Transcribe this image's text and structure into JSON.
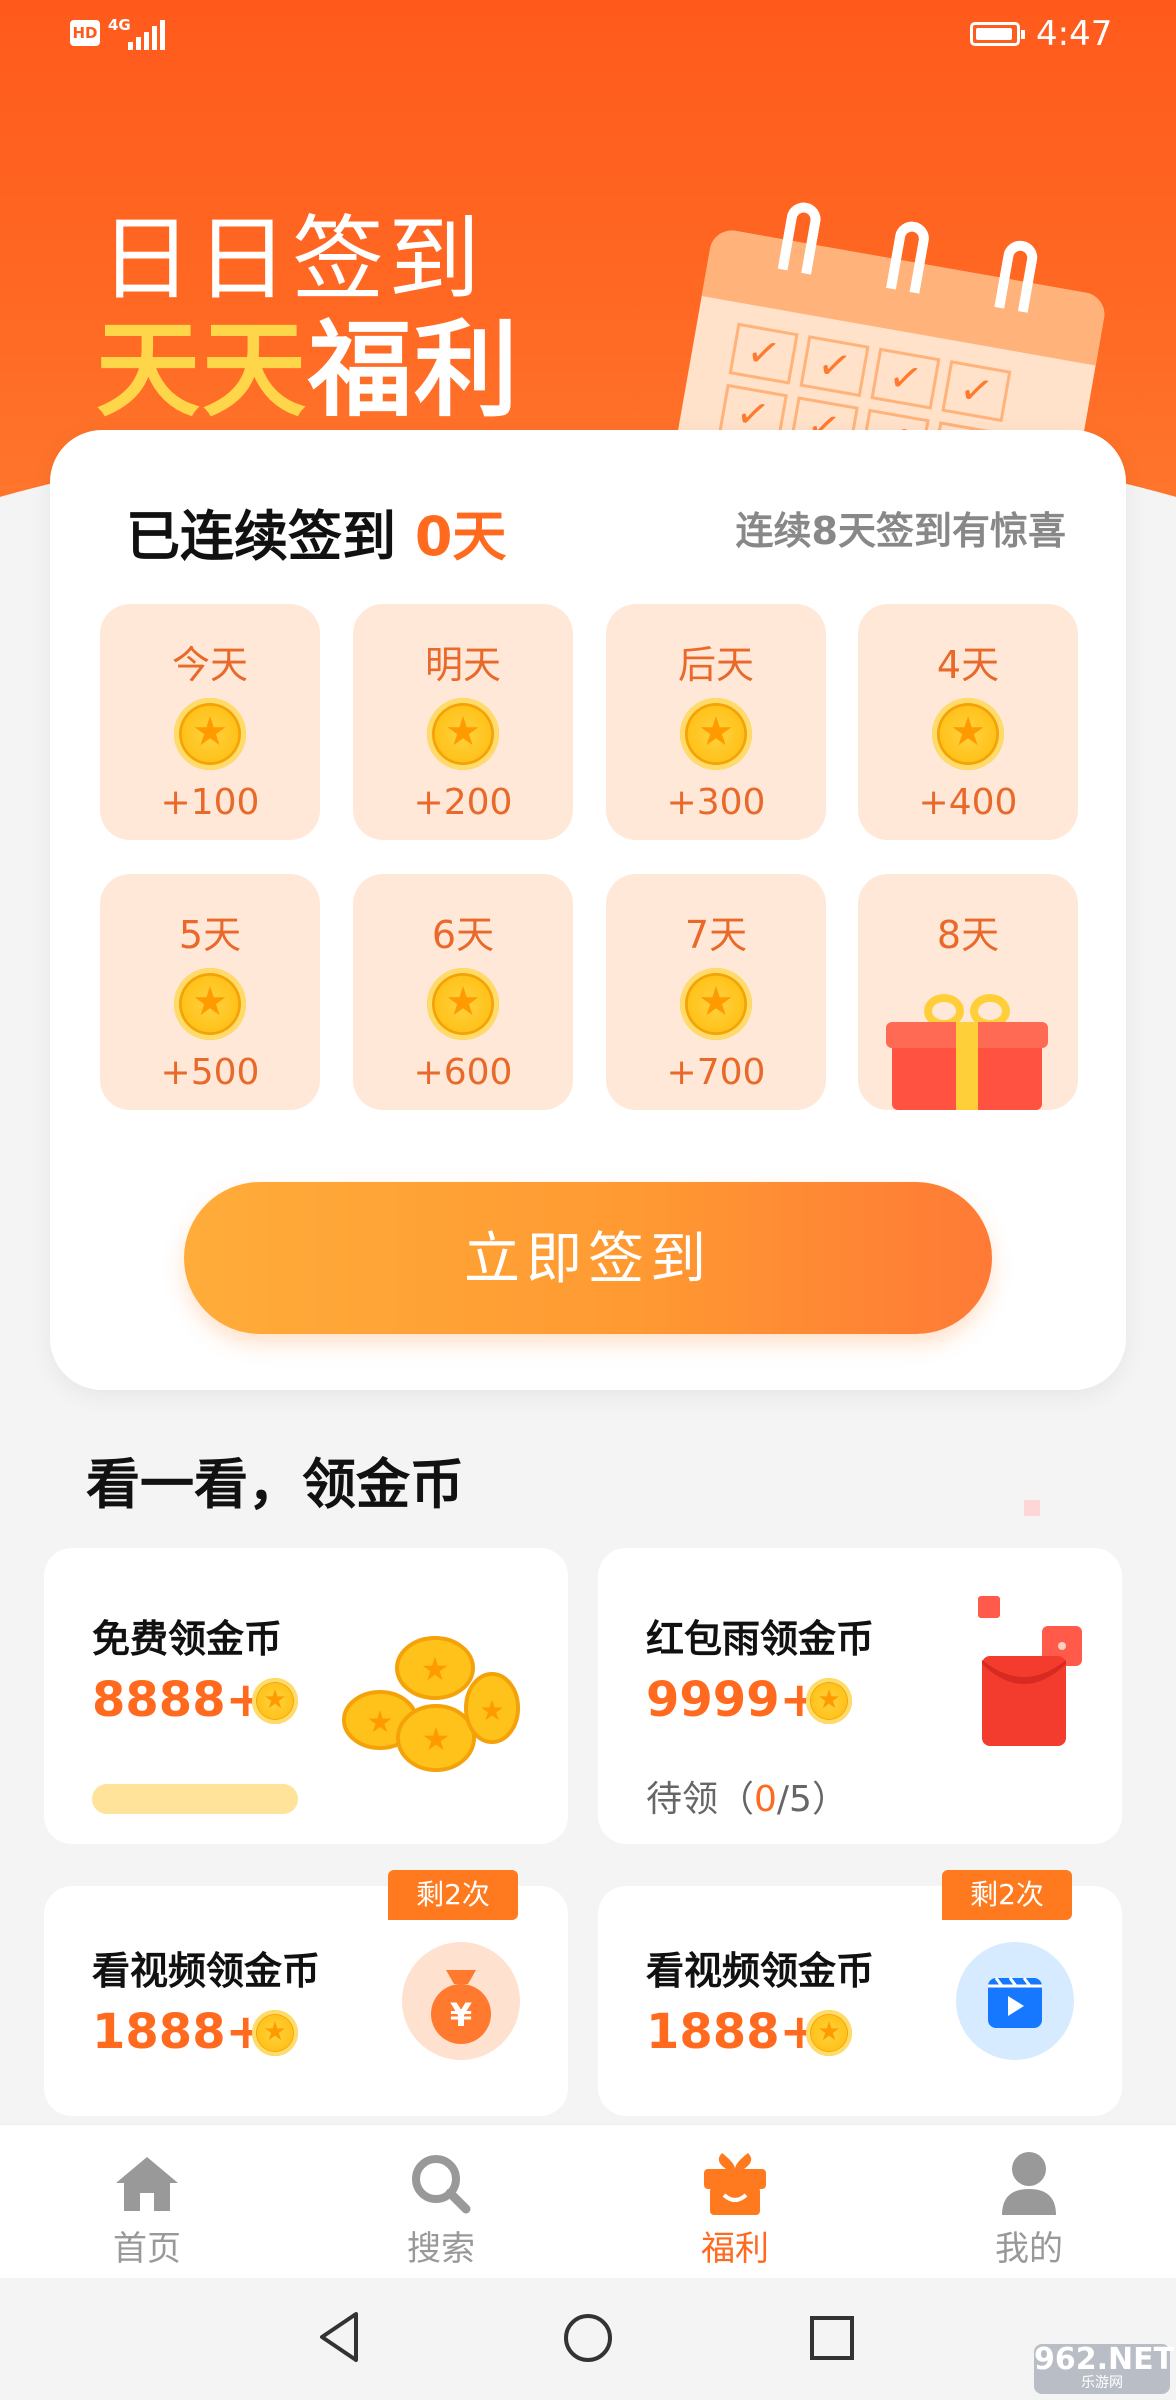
{
  "status_bar": {
    "hd": "HD",
    "network": "4G",
    "time": "4:47"
  },
  "hero": {
    "line1": "日日签到",
    "line2_yellow": "天天",
    "line2_white": "福利",
    "calendar_checks": [
      "✓",
      "✓",
      "✓",
      "✓",
      "✓",
      "✓",
      "✓",
      "✓"
    ]
  },
  "sign": {
    "streak_prefix": "已连续签到 ",
    "streak_days": "0天",
    "hint": "连续8天签到有惊喜",
    "days": [
      {
        "label": "今天",
        "points": "+100"
      },
      {
        "label": "明天",
        "points": "+200"
      },
      {
        "label": "后天",
        "points": "+300"
      },
      {
        "label": "4天",
        "points": "+400"
      },
      {
        "label": "5天",
        "points": "+500"
      },
      {
        "label": "6天",
        "points": "+600"
      },
      {
        "label": "7天",
        "points": "+700"
      },
      {
        "label": "8天",
        "points": ""
      }
    ],
    "button": "立即签到"
  },
  "section_title": "看一看，领金币",
  "cards": [
    {
      "title": "免费领金币",
      "amount": "8888+"
    },
    {
      "title": "红包雨领金币",
      "amount": "9999+",
      "pending_prefix": "待领（",
      "pending_count": "0",
      "pending_suffix": "/5）"
    },
    {
      "title": "看视频领金币",
      "amount": "1888+",
      "badge": "剩2次"
    },
    {
      "title": "看视频领金币",
      "amount": "1888+",
      "badge": "剩2次"
    }
  ],
  "nav": [
    {
      "label": "首页",
      "icon": "home-icon"
    },
    {
      "label": "搜索",
      "icon": "search-icon"
    },
    {
      "label": "福利",
      "icon": "gift-icon",
      "active": true
    },
    {
      "label": "我的",
      "icon": "user-icon"
    }
  ],
  "watermark": {
    "main": "962.NET",
    "sub": "乐游网"
  },
  "colors": {
    "brand": "#ff6a1f",
    "hero": "#ff5a1c",
    "accent_yellow": "#ffd54a"
  }
}
